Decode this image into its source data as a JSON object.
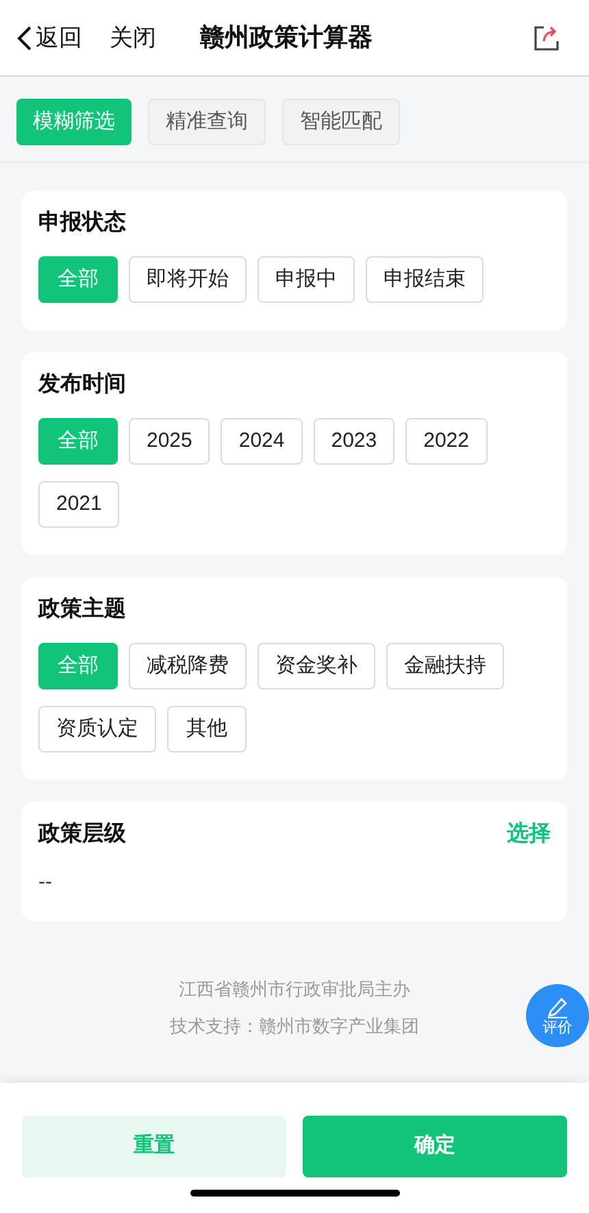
{
  "nav": {
    "back": "返回",
    "close": "关闭",
    "title": "赣州政策计算器"
  },
  "modes": [
    {
      "label": "模糊筛选",
      "selected": true
    },
    {
      "label": "精准查询",
      "selected": false
    },
    {
      "label": "智能匹配",
      "selected": false
    }
  ],
  "filters": [
    {
      "title": "申报状态",
      "options": [
        {
          "label": "全部",
          "selected": true
        },
        {
          "label": "即将开始",
          "selected": false
        },
        {
          "label": "申报中",
          "selected": false
        },
        {
          "label": "申报结束",
          "selected": false
        }
      ]
    },
    {
      "title": "发布时间",
      "options": [
        {
          "label": "全部",
          "selected": true
        },
        {
          "label": "2025",
          "selected": false
        },
        {
          "label": "2024",
          "selected": false
        },
        {
          "label": "2023",
          "selected": false
        },
        {
          "label": "2022",
          "selected": false
        },
        {
          "label": "2021",
          "selected": false
        }
      ]
    },
    {
      "title": "政策主题",
      "options": [
        {
          "label": "全部",
          "selected": true
        },
        {
          "label": "减税降费",
          "selected": false
        },
        {
          "label": "资金奖补",
          "selected": false
        },
        {
          "label": "金融扶持",
          "selected": false
        },
        {
          "label": "资质认定",
          "selected": false
        },
        {
          "label": "其他",
          "selected": false
        }
      ]
    }
  ],
  "level": {
    "title": "政策层级",
    "action": "选择",
    "value": "--"
  },
  "footer": [
    "江西省赣州市行政审批局主办",
    "技术支持：赣州市数字产业集团"
  ],
  "rate_button": "评价",
  "buttons": {
    "reset": "重置",
    "confirm": "确定"
  }
}
